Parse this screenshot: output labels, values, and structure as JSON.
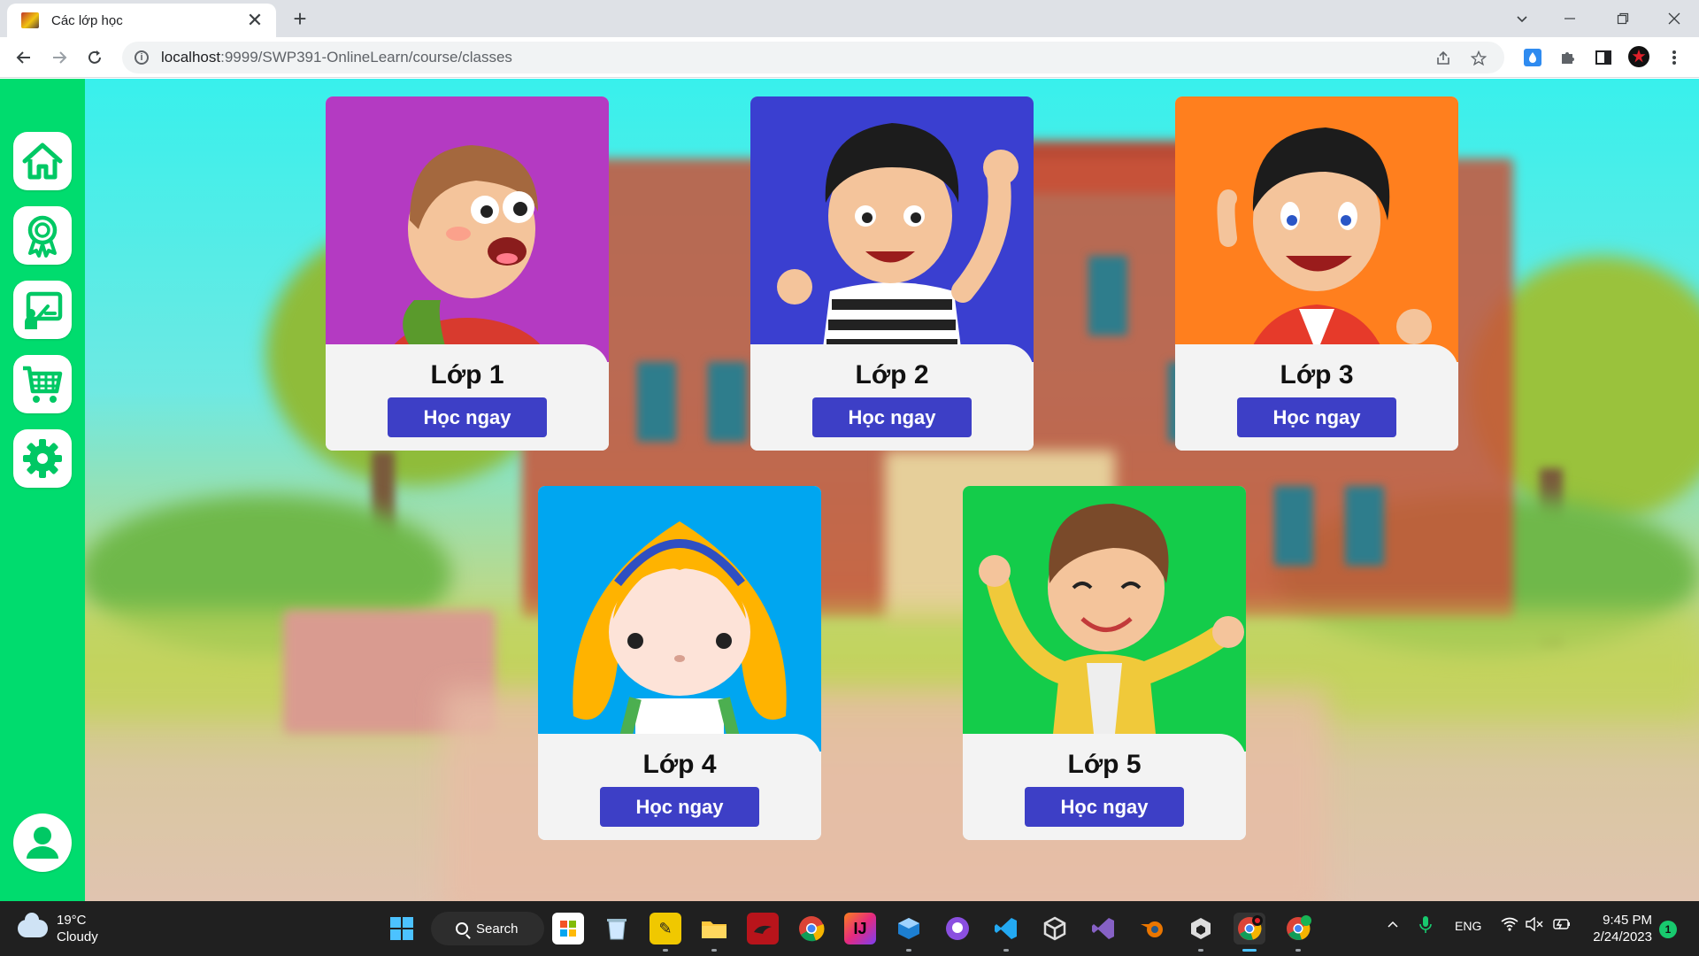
{
  "browser": {
    "tab_title": "Các lớp học",
    "url_host": "localhost",
    "url_path": ":9999/SWP391-OnlineLearn/course/classes",
    "tab_close": "✕",
    "new_tab": "+"
  },
  "sidebar": {
    "items": [
      {
        "name": "home",
        "icon": "home-icon"
      },
      {
        "name": "achievements",
        "icon": "award-badge-icon"
      },
      {
        "name": "classes",
        "icon": "teaching-board-icon"
      },
      {
        "name": "cart",
        "icon": "shopping-cart-icon"
      },
      {
        "name": "settings",
        "icon": "gear-icon"
      },
      {
        "name": "profile",
        "icon": "user-icon"
      }
    ]
  },
  "classes": [
    {
      "title": "Lớp 1",
      "button": "Học ngay",
      "color": "#b43ac2"
    },
    {
      "title": "Lớp 2",
      "button": "Học ngay",
      "color": "#3a3fd0"
    },
    {
      "title": "Lớp 3",
      "button": "Học ngay",
      "color": "#ff7f1e"
    },
    {
      "title": "Lớp 4",
      "button": "Học ngay",
      "color": "#00a6f0"
    },
    {
      "title": "Lớp 5",
      "button": "Học ngay",
      "color": "#14cc4a"
    }
  ],
  "colors": {
    "sidebar": "#00dc6e",
    "button": "#3d3fc6"
  },
  "taskbar": {
    "weather_temp": "19°C",
    "weather_desc": "Cloudy",
    "search_label": "Search",
    "lang": "ENG",
    "time": "9:45 PM",
    "date": "2/24/2023",
    "notification_count": "1"
  }
}
